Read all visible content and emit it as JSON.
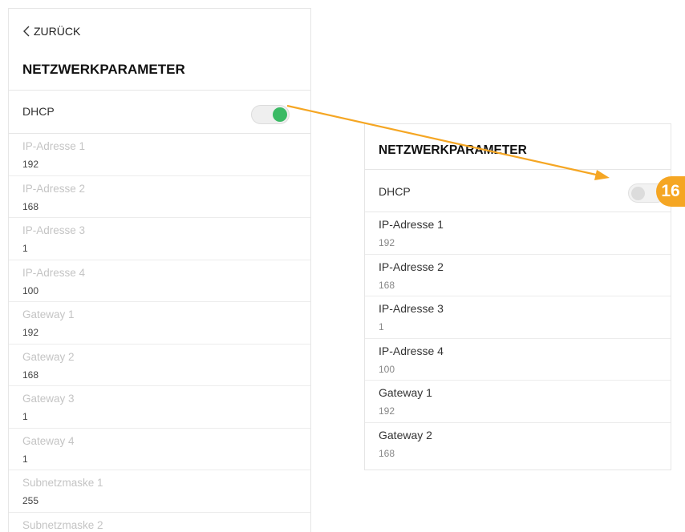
{
  "back": {
    "label": "ZURÜCK"
  },
  "left_panel": {
    "title": "NETZWERKPARAMETER",
    "dhcp": {
      "label": "DHCP",
      "enabled": true
    },
    "fields": [
      {
        "name": "IP-Adresse 1",
        "value": "192"
      },
      {
        "name": "IP-Adresse 2",
        "value": "168"
      },
      {
        "name": "IP-Adresse 3",
        "value": "1"
      },
      {
        "name": "IP-Adresse 4",
        "value": "100"
      },
      {
        "name": "Gateway 1",
        "value": "192"
      },
      {
        "name": "Gateway 2",
        "value": "168"
      },
      {
        "name": "Gateway 3",
        "value": "1"
      },
      {
        "name": "Gateway 4",
        "value": "1"
      },
      {
        "name": "Subnetzmaske 1",
        "value": "255"
      },
      {
        "name": "Subnetzmaske 2",
        "value": ""
      }
    ]
  },
  "right_panel": {
    "title": "NETZWERKPARAMETER",
    "dhcp": {
      "label": "DHCP",
      "enabled": false
    },
    "fields": [
      {
        "name": "IP-Adresse 1",
        "value": "192"
      },
      {
        "name": "IP-Adresse 2",
        "value": "168"
      },
      {
        "name": "IP-Adresse 3",
        "value": "1"
      },
      {
        "name": "IP-Adresse 4",
        "value": "100"
      },
      {
        "name": "Gateway 1",
        "value": "192"
      },
      {
        "name": "Gateway 2",
        "value": "168"
      }
    ]
  },
  "callout": {
    "number": "16"
  },
  "colors": {
    "toggle_on": "#3aba64",
    "callout": "#f5a623",
    "disabled_text": "#c4c4c4"
  }
}
